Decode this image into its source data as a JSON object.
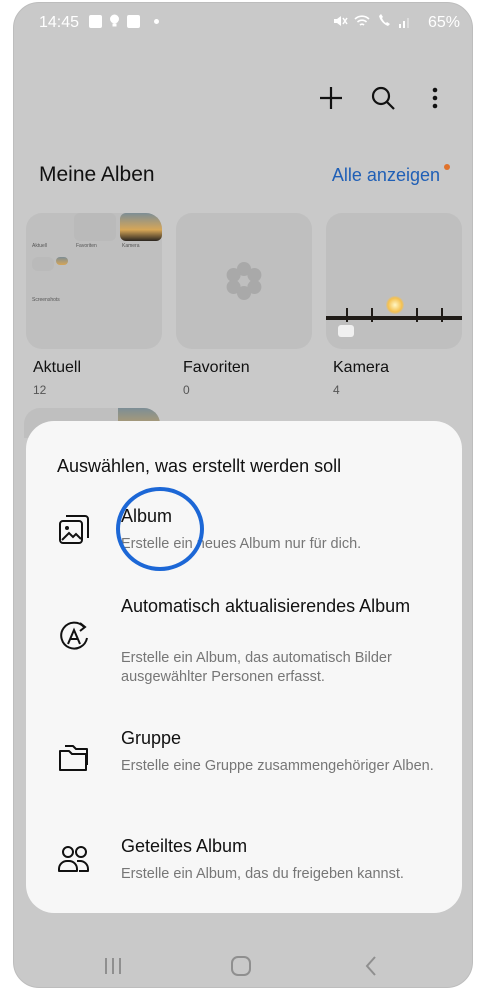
{
  "status_bar": {
    "time": "14:45",
    "battery": "65%"
  },
  "toolbar": {
    "add_icon": "plus-icon",
    "search_icon": "search-icon",
    "more_icon": "more-vertical-icon"
  },
  "albums_section": {
    "title": "Meine Alben",
    "see_all": "Alle anzeigen",
    "albums": [
      {
        "name": "Aktuell",
        "count": "12"
      },
      {
        "name": "Favoriten",
        "count": "0"
      },
      {
        "name": "Kamera",
        "count": "4"
      }
    ],
    "collage_labels": {
      "aktuell": "Aktuell",
      "favoriten": "Favoriten",
      "kamera": "Kamera",
      "screenshots": "Screenshots"
    }
  },
  "create_sheet": {
    "title": "Auswählen, was erstellt werden soll",
    "options": [
      {
        "title": "Album",
        "description": "Erstelle ein neues Album nur für dich.",
        "icon": "album-icon"
      },
      {
        "title": "Automatisch aktualisierendes Album",
        "description": "Erstelle ein Album, das automatisch Bilder ausgewählter Personen erfasst.",
        "icon": "auto-update-album-icon"
      },
      {
        "title": "Gruppe",
        "description": "Erstelle eine Gruppe zusammengehöriger Alben.",
        "icon": "folder-group-icon"
      },
      {
        "title": "Geteiltes Album",
        "description": "Erstelle ein Album, das du freigeben kannst.",
        "icon": "shared-people-icon"
      }
    ]
  },
  "colors": {
    "accent": "#1f5fb6",
    "highlight_ring": "#1c67d6",
    "badge_dot": "#e0722b",
    "dimmed_background": "#c9c9c9",
    "sheet_background": "#f7f7f7"
  }
}
